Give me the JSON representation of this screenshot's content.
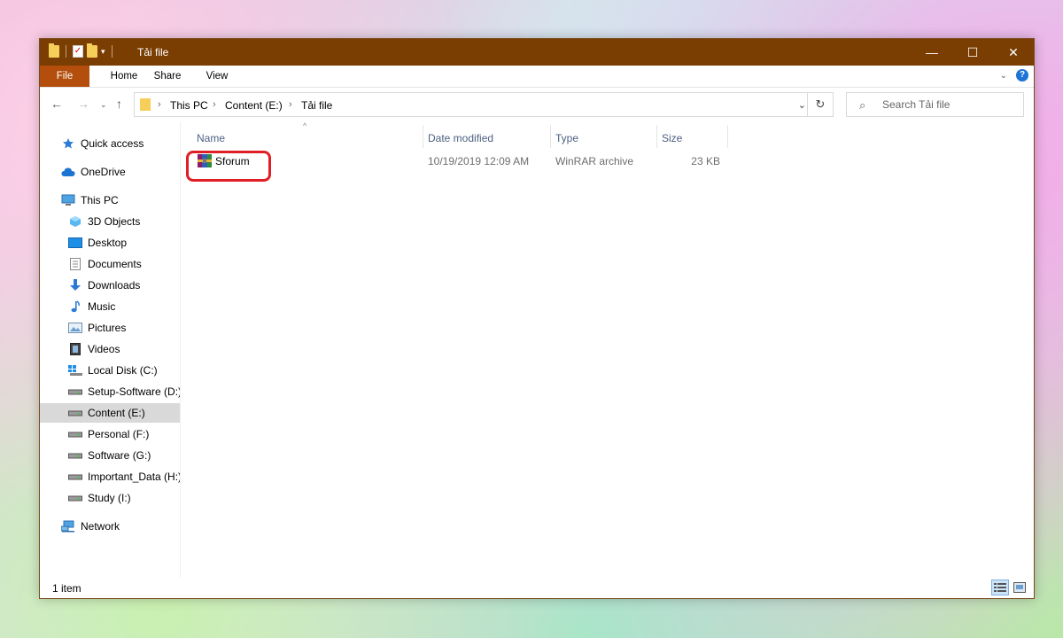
{
  "window": {
    "title": "Tải file",
    "minimize": "—",
    "maximize": "☐",
    "close": "✕"
  },
  "ribbon": {
    "tabs": [
      "File",
      "Home",
      "Share",
      "View"
    ]
  },
  "address": {
    "crumbs": [
      "This PC",
      "Content (E:)",
      "Tải file"
    ],
    "search_placeholder": "Search Tải file"
  },
  "nav": {
    "quick_access": "Quick access",
    "onedrive": "OneDrive",
    "this_pc": "This PC",
    "items": [
      "3D Objects",
      "Desktop",
      "Documents",
      "Downloads",
      "Music",
      "Pictures",
      "Videos",
      "Local Disk (C:)",
      "Setup-Software (D:)",
      "Content (E:)",
      "Personal (F:)",
      "Software (G:)",
      "Important_Data (H:)",
      "Study (I:)"
    ],
    "network": "Network",
    "selected": "Content (E:)"
  },
  "columns": {
    "name": "Name",
    "date": "Date modified",
    "type": "Type",
    "size": "Size"
  },
  "files": [
    {
      "name": "Sforum",
      "date": "10/19/2019 12:09 AM",
      "type": "WinRAR archive",
      "size": "23 KB"
    }
  ],
  "status": {
    "item_count": "1 item"
  },
  "colors": {
    "titlebar": "#7a3d02",
    "file_tab": "#b34e0c",
    "highlight": "#e01e25"
  }
}
